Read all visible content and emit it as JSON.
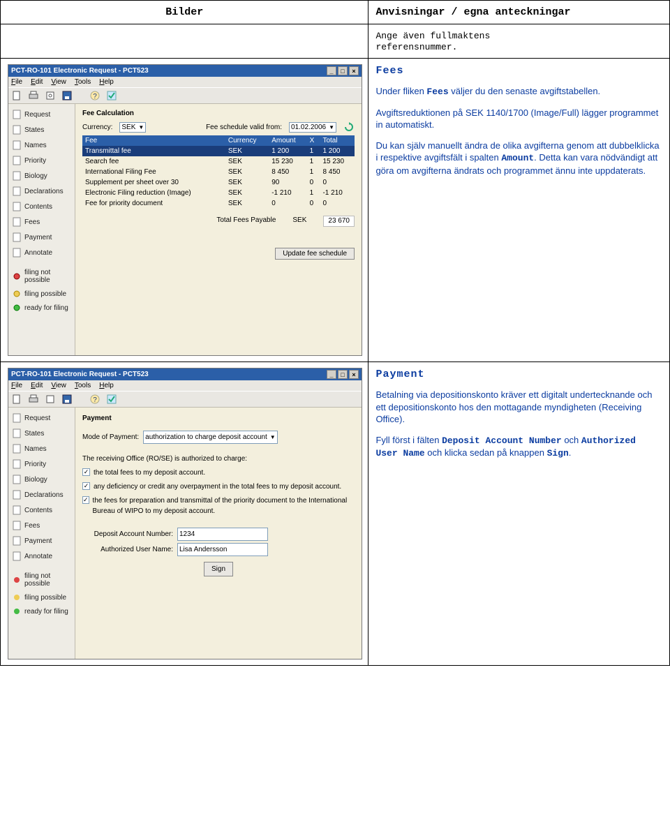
{
  "header": {
    "left": "Bilder",
    "right": "Anvisningar / egna anteckningar"
  },
  "row1": {
    "line1": "Ange även fullmaktens",
    "line2": "referensnummer."
  },
  "fees_text": {
    "heading": "Fees",
    "p1a": "Under fliken ",
    "p1b": "Fees",
    "p1c": " väljer du den senaste avgiftstabellen.",
    "p2": "Avgiftsreduktionen på SEK 1140/1700 (Image/Full) lägger programmet in automatiskt.",
    "p3a": "Du kan själv manuellt ändra de olika avgifterna genom att dubbelklicka i respektive avgiftsfält i spalten ",
    "p3b": "Amount",
    "p3c": ". Detta kan vara nödvändigt att göra om avgifterna ändrats och programmet ännu inte uppdaterats."
  },
  "payment_text": {
    "heading": "Payment",
    "p1": "Betalning via depositionskonto kräver ett digitalt undertecknande och ett depositionskonto hos den mottagande myndigheten (Receiving Office).",
    "p2a": "Fyll först i fälten ",
    "p2b": "Deposit Account Number",
    "p2c": " och ",
    "p2d": "Authorized User Name",
    "p2e": " och klicka sedan på knappen ",
    "p2f": "Sign",
    "p2g": "."
  },
  "win_common": {
    "title": "PCT-RO-101 Electronic Request - PCT523",
    "menu": {
      "file": "File",
      "edit": "Edit",
      "view": "View",
      "tools": "Tools",
      "help": "Help"
    },
    "sidebar": [
      "Request",
      "States",
      "Names",
      "Priority",
      "Biology",
      "Declarations",
      "Contents",
      "Fees",
      "Payment",
      "Annotate"
    ],
    "status": [
      "filing not possible",
      "filing possible",
      "ready for filing"
    ]
  },
  "fees_screen": {
    "heading": "Fee Calculation",
    "currency_label": "Currency:",
    "currency_value": "SEK",
    "schedule_label": "Fee schedule valid from:",
    "schedule_value": "01.02.2006",
    "cols": [
      "Fee",
      "Currency",
      "Amount",
      "X",
      "Total"
    ],
    "rows": [
      {
        "fee": "Transmittal fee",
        "cur": "SEK",
        "amt": "1 200",
        "x": "1",
        "tot": "1 200",
        "sel": true
      },
      {
        "fee": "Search fee",
        "cur": "SEK",
        "amt": "15 230",
        "x": "1",
        "tot": "15 230"
      },
      {
        "fee": "International Filing Fee",
        "cur": "SEK",
        "amt": "8 450",
        "x": "1",
        "tot": "8 450"
      },
      {
        "fee": "Supplement per sheet over 30",
        "cur": "SEK",
        "amt": "90",
        "x": "0",
        "tot": "0"
      },
      {
        "fee": "Electronic Filing reduction (Image)",
        "cur": "SEK",
        "amt": "-1 210",
        "x": "1",
        "tot": "-1 210"
      },
      {
        "fee": "Fee for priority document",
        "cur": "SEK",
        "amt": "0",
        "x": "0",
        "tot": "0"
      }
    ],
    "total_label": "Total Fees Payable",
    "total_cur": "SEK",
    "total_value": "23 670",
    "update_btn": "Update fee schedule"
  },
  "payment_screen": {
    "heading": "Payment",
    "mode_label": "Mode of Payment:",
    "mode_value": "authorization to charge deposit account",
    "auth_text": "The receiving Office (RO/SE) is authorized to charge:",
    "chk1": "the total fees to my deposit account.",
    "chk2": "any deficiency or credit any overpayment in the total fees to my deposit account.",
    "chk3": "the fees for preparation and transmittal of the priority document to the International Bureau of WIPO to my deposit account.",
    "acct_label": "Deposit Account Number:",
    "acct_value": "1234",
    "user_label": "Authorized User Name:",
    "user_value": "Lisa Andersson",
    "sign_btn": "Sign"
  }
}
